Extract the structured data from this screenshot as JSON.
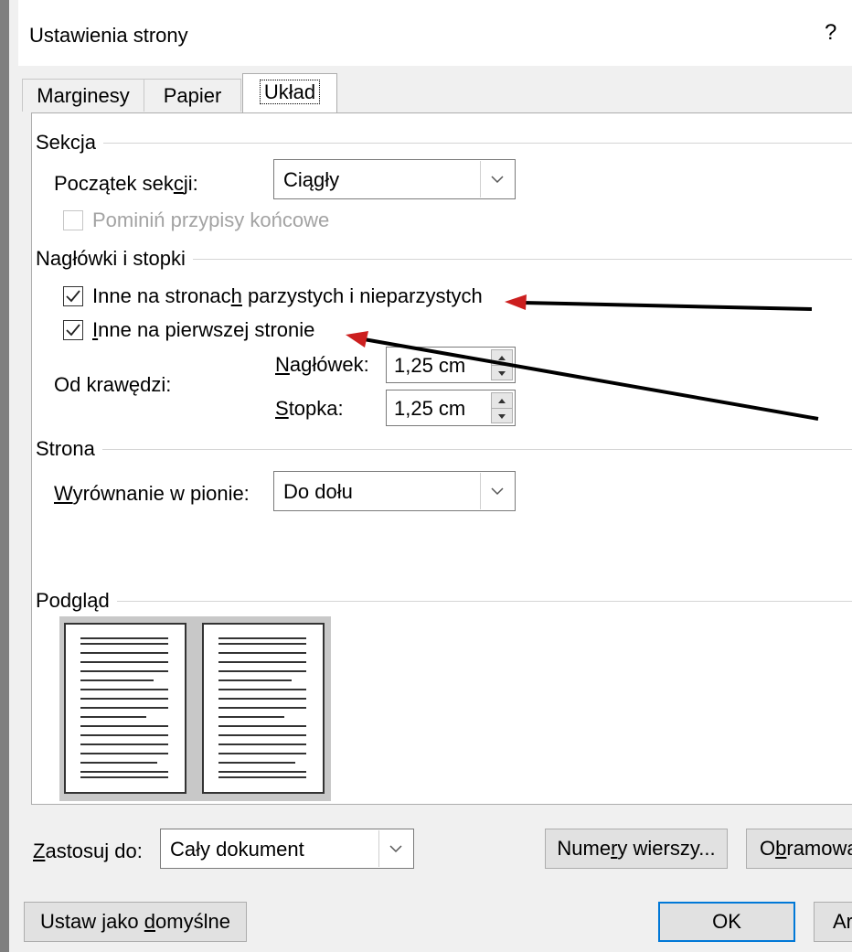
{
  "dialog": {
    "title": "Ustawienia strony",
    "help": "?"
  },
  "tabs": [
    {
      "label": "Marginesy",
      "active": false
    },
    {
      "label": "Papier",
      "active": false
    },
    {
      "label": "Układ",
      "active": true
    }
  ],
  "section": {
    "group_title": "Sekcja",
    "start_label_pre": "Początek sek",
    "start_label_u": "c",
    "start_label_post": "ji:",
    "start_value": "Ciągły",
    "suppress_endnotes_label": "Pominiń przypisy końcowe",
    "suppress_endnotes_checked": false,
    "suppress_endnotes_disabled": true
  },
  "headers_footers": {
    "group_title": "Nagłówki i stopki",
    "odd_even_pre": "Inne na stronac",
    "odd_even_u": "h",
    "odd_even_post": " parzystych i nieparzystych",
    "odd_even_checked": true,
    "first_page_u": "I",
    "first_page_post": "nne na pierwszej stronie",
    "first_page_checked": true,
    "from_edge_label": "Od krawędzi:",
    "header_label_u": "N",
    "header_label_post": "agłówek:",
    "header_value": "1,25 cm",
    "footer_label_u": "S",
    "footer_label_post": "topka:",
    "footer_value": "1,25 cm"
  },
  "page": {
    "group_title": "Strona",
    "valign_label_u": "W",
    "valign_label_post": "yrównanie w pionie:",
    "valign_value": "Do dołu"
  },
  "preview": {
    "group_title": "Podgląd"
  },
  "apply": {
    "label_u": "Z",
    "label_post": "astosuj do:",
    "value": "Cały dokument"
  },
  "buttons": {
    "line_numbers_pre": "Nume",
    "line_numbers_u": "r",
    "line_numbers_post": "y wierszy...",
    "borders_pre": "O",
    "borders_u": "b",
    "borders_post": "ramowa",
    "set_default_pre": "Ustaw jako ",
    "set_default_u": "d",
    "set_default_post": "omyślne",
    "ok": "OK",
    "cancel_partial": "Ar"
  },
  "colors": {
    "arrow_line": "#000000",
    "arrow_head": "#cc1f1f",
    "default_button_border": "#0078d7"
  }
}
